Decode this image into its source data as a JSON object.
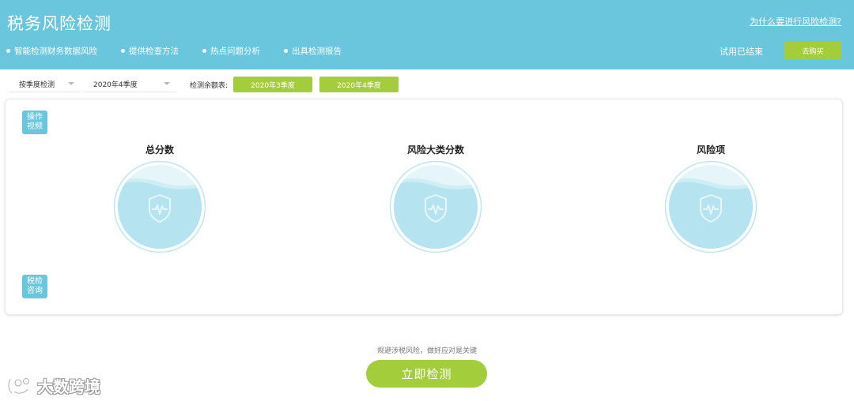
{
  "header": {
    "title": "税务风险检测",
    "why_link": "为什么要进行风险检测?",
    "features": [
      "智能检测财务数据风险",
      "提供检查方法",
      "热点问题分析",
      "出具检测报告"
    ],
    "trial_status": "试用已结束",
    "buy_label": "去购买"
  },
  "toolbar": {
    "mode_select": "按季度检测",
    "period_select": "2020年4季度",
    "balance_label": "检测余额表:",
    "seasons": [
      "2020年3季度",
      "2020年4季度"
    ]
  },
  "card": {
    "side_buttons": {
      "video": [
        "操作",
        "视频"
      ],
      "consult": [
        "税检",
        "咨询"
      ]
    },
    "metrics": [
      "总分数",
      "风险大类分数",
      "风险项"
    ]
  },
  "footer": {
    "tip": "规避涉税风险，做好应对是关键",
    "detect_label": "立即检测",
    "watermark": "大数跨境"
  },
  "colors": {
    "header": "#69c6dc",
    "accent_green": "#a3cd3b",
    "gauge_fill": "#b5e3ef"
  }
}
